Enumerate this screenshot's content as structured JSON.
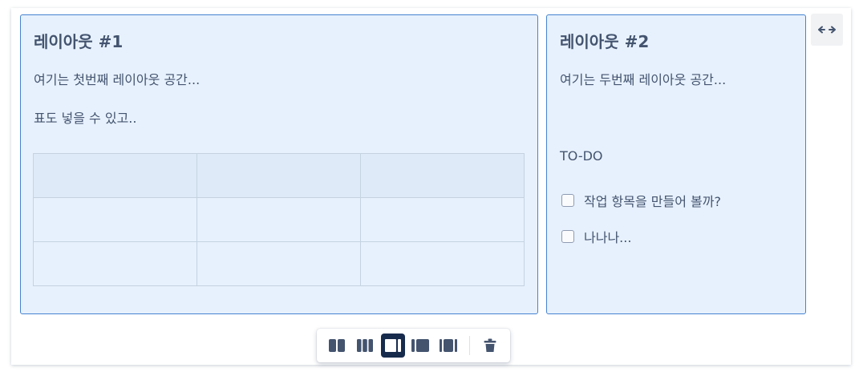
{
  "layout1": {
    "heading": "레이아웃 #1",
    "text1": "여기는 첫번째 레이아웃 공간...",
    "text2": "표도 넣을 수 있고..",
    "table": {
      "rows": 3,
      "cols": 3,
      "cells": [
        [
          "",
          "",
          ""
        ],
        [
          "",
          "",
          ""
        ],
        [
          "",
          "",
          ""
        ]
      ]
    }
  },
  "layout2": {
    "heading": "레이아웃 #2",
    "text1": "여기는 두번째 레이아웃 공간...",
    "todo_title": "TO-DO",
    "tasks": [
      {
        "label": "작업 항목을 만들어 볼까?",
        "checked": false
      },
      {
        "label": "나나나...",
        "checked": false
      }
    ]
  },
  "toolbar": {
    "buttons": [
      {
        "icon": "two-columns-icon",
        "selected": false
      },
      {
        "icon": "three-columns-icon",
        "selected": false
      },
      {
        "icon": "right-sidebar-icon",
        "selected": true
      },
      {
        "icon": "left-sidebar-icon",
        "selected": false
      },
      {
        "icon": "three-columns-with-sidebars-icon",
        "selected": false
      },
      {
        "icon": "trash-icon",
        "selected": false
      }
    ]
  },
  "expand": {
    "icon": "expand-width-icon"
  },
  "colors": {
    "panel_bg": "#e7f1fd",
    "panel_border": "#4683d1",
    "text": "#44546f",
    "icon": "#44546f",
    "selected": "#172b4d"
  }
}
